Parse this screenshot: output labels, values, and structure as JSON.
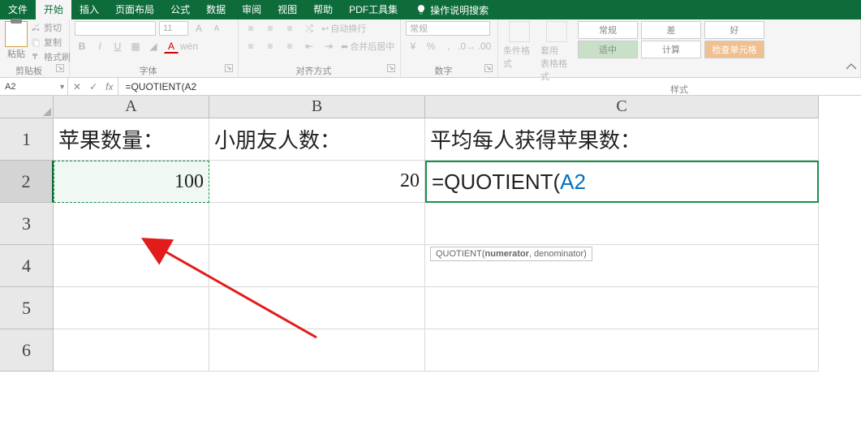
{
  "menu": {
    "file": "文件",
    "home": "开始",
    "insert": "插入",
    "layout": "页面布局",
    "formulas": "公式",
    "data": "数据",
    "review": "审阅",
    "view": "视图",
    "help": "帮助",
    "pdf": "PDF工具集",
    "tell_me": "操作说明搜索"
  },
  "ribbon": {
    "clipboard": {
      "label": "剪贴板",
      "paste": "粘贴",
      "cut": "剪切",
      "copy": "复制",
      "format_painter": "格式刷"
    },
    "font": {
      "label": "字体",
      "size": "11"
    },
    "align": {
      "label": "对齐方式",
      "wrap": "自动换行",
      "merge": "合并后居中"
    },
    "number": {
      "label": "数字",
      "format": "常规"
    },
    "styles": {
      "label": "样式",
      "cond": "条件格式",
      "table": "套用\n表格格式",
      "s1": "常规",
      "s2": "差",
      "s3": "好",
      "s4": "适中",
      "s5": "计算",
      "s6": "检查单元格"
    }
  },
  "formula_bar": {
    "name_box": "A2",
    "formula": "=QUOTIENT(A2"
  },
  "sheet": {
    "cols": [
      "A",
      "B",
      "C"
    ],
    "rows": [
      "1",
      "2",
      "3",
      "4",
      "5",
      "6"
    ],
    "A1": "苹果数量：",
    "B1": "小朋友人数：",
    "C1": "平均每人获得苹果数：",
    "A2": "100",
    "B2": "20",
    "C2_prefix": "=QUOTIENT(",
    "C2_ref": "A2"
  },
  "tooltip": {
    "fn": "QUOTIENT",
    "sig_open": "(",
    "arg1": "numerator",
    "sep": ", denominator)"
  }
}
